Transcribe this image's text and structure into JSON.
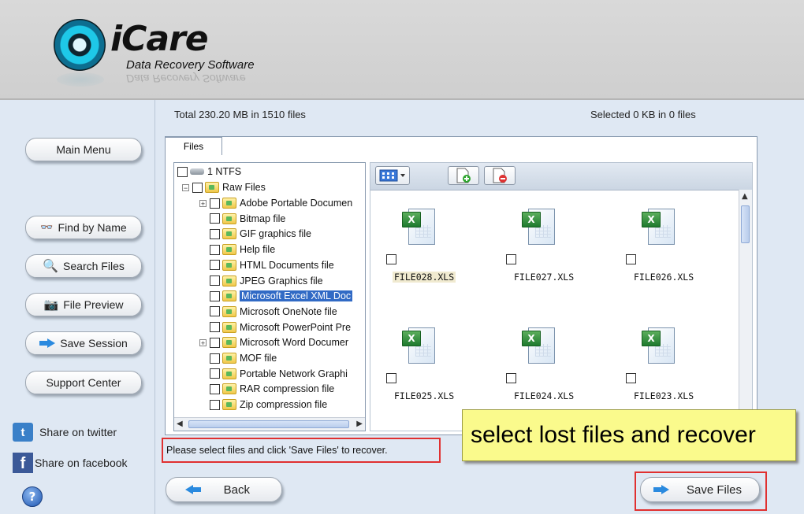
{
  "header": {
    "logo_name": "iCare",
    "logo_tagline": "Data Recovery Software"
  },
  "sidebar": {
    "buttons": [
      {
        "label": "Main Menu",
        "icon": "none"
      },
      {
        "label": "Find by Name",
        "icon": "binoculars-icon"
      },
      {
        "label": "Search Files",
        "icon": "magnifier-icon"
      },
      {
        "label": "File Preview",
        "icon": "camera-icon"
      },
      {
        "label": "Save Session",
        "icon": "arrow-right-icon"
      },
      {
        "label": "Support Center",
        "icon": "none"
      }
    ],
    "share": [
      {
        "label": "Share on twitter",
        "icon": "twitter-icon"
      },
      {
        "label": "Share on facebook",
        "icon": "facebook-icon"
      }
    ],
    "help_glyph": "?"
  },
  "summary": {
    "total": "Total 230.20 MB in 1510 files",
    "selected": "Selected 0 KB in 0 files"
  },
  "tabs": [
    {
      "label": "Files",
      "active": true
    }
  ],
  "tree": {
    "root": "1 NTFS",
    "group": "Raw Files",
    "items": [
      {
        "label": "Adobe Portable Documen",
        "expandable": true,
        "selected": false
      },
      {
        "label": "Bitmap file",
        "expandable": false,
        "selected": false
      },
      {
        "label": "GIF graphics file",
        "expandable": false,
        "selected": false
      },
      {
        "label": "Help file",
        "expandable": false,
        "selected": false
      },
      {
        "label": "HTML Documents file",
        "expandable": false,
        "selected": false
      },
      {
        "label": "JPEG Graphics file",
        "expandable": false,
        "selected": false
      },
      {
        "label": "Microsoft Excel XML Doc",
        "expandable": false,
        "selected": true
      },
      {
        "label": "Microsoft OneNote file",
        "expandable": false,
        "selected": false
      },
      {
        "label": "Microsoft PowerPoint Pre",
        "expandable": false,
        "selected": false
      },
      {
        "label": "Microsoft Word Documer",
        "expandable": true,
        "selected": false
      },
      {
        "label": "MOF file",
        "expandable": false,
        "selected": false
      },
      {
        "label": "Portable Network Graphi",
        "expandable": false,
        "selected": false
      },
      {
        "label": "RAR compression file",
        "expandable": false,
        "selected": false
      },
      {
        "label": "Zip compression file",
        "expandable": false,
        "selected": false
      }
    ]
  },
  "files": [
    {
      "name": "FILE028.XLS",
      "highlighted": true
    },
    {
      "name": "FILE027.XLS",
      "highlighted": false
    },
    {
      "name": "FILE026.XLS",
      "highlighted": false
    },
    {
      "name": "FILE025.XLS",
      "highlighted": false
    },
    {
      "name": "FILE024.XLS",
      "highlighted": false
    },
    {
      "name": "FILE023.XLS",
      "highlighted": false
    }
  ],
  "status_message": "Please select files and click 'Save Files' to recover.",
  "callout": "select lost files and recover",
  "buttons": {
    "back": "Back",
    "save_files": "Save Files"
  },
  "colors": {
    "accent_red": "#e03030",
    "callout_yellow": "#fafa8c",
    "selection_blue": "#316ac5"
  }
}
